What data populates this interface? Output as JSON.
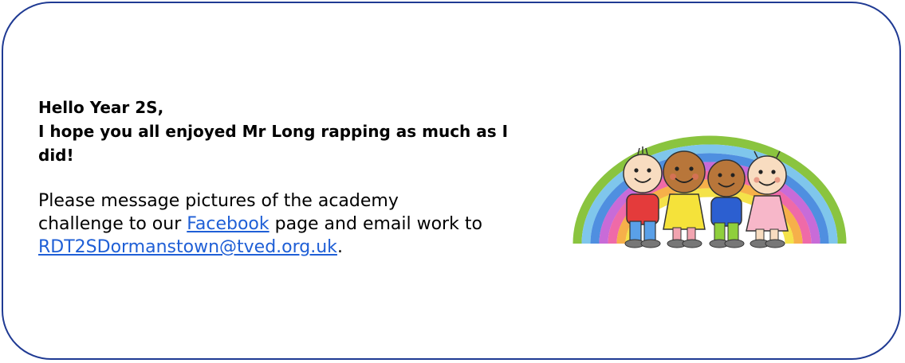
{
  "greeting": {
    "line1": "Hello Year 2S,",
    "line2": "I hope you all enjoyed Mr Long rapping as much as I did!"
  },
  "message": {
    "part1": "Please message pictures of the academy challenge to our ",
    "facebook_link": "Facebook",
    "part2": " page and email work to ",
    "email_link": "RDT2SDormanstown@tved.org.uk",
    "part3": "."
  },
  "illustration": {
    "icon": "children-rainbow-illustration",
    "colors": {
      "border": "#1f3a93",
      "link": "#1f5fd6"
    }
  }
}
